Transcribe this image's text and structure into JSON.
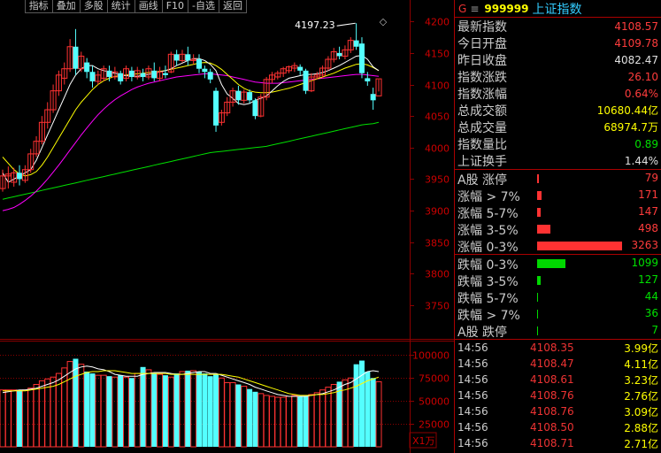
{
  "toolbar": [
    "指标",
    "叠加",
    "多股",
    "统计",
    "画线",
    "F10",
    "-自选",
    "返回"
  ],
  "chart_data": {
    "type": "candlestick",
    "price_axis": {
      "ticks": [
        4200,
        4150,
        4100,
        4050,
        4000,
        3950,
        3900,
        3850,
        3800,
        3750
      ],
      "ylim": [
        3698,
        4213
      ]
    },
    "volume_axis": {
      "ticks": [
        100000,
        75000,
        50000,
        25000
      ],
      "ylim": [
        0,
        109000
      ],
      "unit_label": "X1万"
    },
    "high_annotation": "4197.23",
    "candles": [
      [
        3935,
        3955,
        3930,
        3965
      ],
      [
        3955,
        3958,
        3935,
        3970
      ],
      [
        3945,
        3960,
        3938,
        3968
      ],
      [
        3960,
        3950,
        3940,
        3972
      ],
      [
        3948,
        3965,
        3944,
        3972
      ],
      [
        3965,
        3990,
        3960,
        3998
      ],
      [
        3990,
        4010,
        3985,
        4018
      ],
      [
        4010,
        4040,
        4005,
        4050
      ],
      [
        4040,
        4060,
        4030,
        4072
      ],
      [
        4060,
        4090,
        4055,
        4100
      ],
      [
        4090,
        4115,
        4082,
        4122
      ],
      [
        4110,
        4125,
        4100,
        4135
      ],
      [
        4125,
        4160,
        4120,
        4172
      ],
      [
        4160,
        4125,
        4115,
        4188
      ],
      [
        4125,
        4145,
        4120,
        4152
      ],
      [
        4135,
        4120,
        4110,
        4142
      ],
      [
        4120,
        4105,
        4095,
        4130
      ],
      [
        4105,
        4115,
        4100,
        4122
      ],
      [
        4110,
        4125,
        4105,
        4130
      ],
      [
        4122,
        4112,
        4105,
        4130
      ],
      [
        4112,
        4120,
        4108,
        4128
      ],
      [
        4118,
        4105,
        4100,
        4122
      ],
      [
        4110,
        4125,
        4105,
        4130
      ],
      [
        4122,
        4112,
        4105,
        4128
      ],
      [
        4112,
        4122,
        4108,
        4128
      ],
      [
        4118,
        4112,
        4105,
        4125
      ],
      [
        4112,
        4125,
        4108,
        4130
      ],
      [
        4122,
        4110,
        4105,
        4135
      ],
      [
        4110,
        4120,
        4105,
        4128
      ],
      [
        4118,
        4115,
        4110,
        4130
      ],
      [
        4120,
        4148,
        4118,
        4152
      ],
      [
        4148,
        4138,
        4130,
        4155
      ],
      [
        4138,
        4148,
        4135,
        4155
      ],
      [
        4148,
        4138,
        4130,
        4160
      ],
      [
        4138,
        4140,
        4132,
        4148
      ],
      [
        4140,
        4125,
        4118,
        4148
      ],
      [
        4125,
        4120,
        4110,
        4130
      ],
      [
        4120,
        4108,
        4102,
        4125
      ],
      [
        4090,
        4035,
        4025,
        4095
      ],
      [
        4040,
        4055,
        4035,
        4060
      ],
      [
        4055,
        4072,
        4050,
        4080
      ],
      [
        4072,
        4090,
        4065,
        4095
      ],
      [
        4090,
        4075,
        4068,
        4098
      ],
      [
        4075,
        4088,
        4070,
        4092
      ],
      [
        4088,
        4075,
        4070,
        4092
      ],
      [
        4075,
        4050,
        4045,
        4078
      ],
      [
        4050,
        4080,
        4048,
        4085
      ],
      [
        4080,
        4108,
        4075,
        4112
      ],
      [
        4108,
        4115,
        4102,
        4120
      ],
      [
        4112,
        4118,
        4108,
        4122
      ],
      [
        4118,
        4125,
        4112,
        4128
      ],
      [
        4122,
        4128,
        4118,
        4130
      ],
      [
        4126,
        4130,
        4120,
        4135
      ],
      [
        4128,
        4122,
        4115,
        4132
      ],
      [
        4122,
        4090,
        4085,
        4125
      ],
      [
        4090,
        4112,
        4088,
        4118
      ],
      [
        4112,
        4115,
        4108,
        4120
      ],
      [
        4115,
        4126,
        4110,
        4130
      ],
      [
        4126,
        4140,
        4122,
        4145
      ],
      [
        4140,
        4152,
        4135,
        4158
      ],
      [
        4150,
        4145,
        4140,
        4160
      ],
      [
        4145,
        4155,
        4140,
        4162
      ],
      [
        4155,
        4170,
        4150,
        4175
      ],
      [
        4170,
        4160,
        4155,
        4197.23
      ],
      [
        4165,
        4118,
        4110,
        4175
      ],
      [
        4110,
        4105,
        4098,
        4120
      ],
      [
        4085,
        4075,
        4060,
        4095
      ],
      [
        4082,
        4109,
        4089,
        4108
      ]
    ],
    "ma5": [
      3960,
      3945,
      3950,
      3955,
      3960,
      3965,
      3980,
      4000,
      4020,
      4040,
      4060,
      4080,
      4100,
      4115,
      4125,
      4130,
      4130,
      4125,
      4122,
      4120,
      4118,
      4115,
      4114,
      4113,
      4113,
      4115,
      4116,
      4118,
      4120,
      4122,
      4125,
      4130,
      4134,
      4138,
      4141,
      4141,
      4138,
      4132,
      4122,
      4100,
      4085,
      4078,
      4070,
      4068,
      4070,
      4075,
      4078,
      4082,
      4090,
      4098,
      4105,
      4110,
      4112,
      4114,
      4116,
      4116,
      4117,
      4119,
      4122,
      4126,
      4130,
      4135,
      4140,
      4145,
      4146,
      4140,
      4128,
      4122
    ],
    "ma10": [
      3985,
      3975,
      3965,
      3958,
      3955,
      3957,
      3962,
      3972,
      3985,
      4000,
      4015,
      4030,
      4045,
      4060,
      4072,
      4082,
      4092,
      4100,
      4106,
      4110,
      4113,
      4114,
      4115,
      4116,
      4117,
      4118,
      4119,
      4120,
      4121,
      4122,
      4124,
      4126,
      4128,
      4130,
      4132,
      4134,
      4135,
      4134,
      4130,
      4124,
      4116,
      4108,
      4100,
      4094,
      4090,
      4088,
      4087,
      4087,
      4088,
      4090,
      4092,
      4094,
      4097,
      4100,
      4103,
      4106,
      4109,
      4112,
      4115,
      4118,
      4122,
      4126,
      4129,
      4132,
      4133,
      4131,
      4127,
      4122
    ],
    "ma20": [
      3900,
      3902,
      3905,
      3910,
      3916,
      3923,
      3931,
      3940,
      3950,
      3961,
      3972,
      3984,
      3996,
      4008,
      4020,
      4031,
      4042,
      4052,
      4061,
      4069,
      4076,
      4082,
      4087,
      4092,
      4096,
      4099,
      4102,
      4104,
      4106,
      4108,
      4110,
      4112,
      4113,
      4114,
      4115,
      4116,
      4117,
      4117,
      4116,
      4115,
      4114,
      4112,
      4110,
      4108,
      4106,
      4104,
      4103,
      4102,
      4102,
      4102,
      4103,
      4104,
      4105,
      4106,
      4107,
      4108,
      4109,
      4110,
      4111,
      4112,
      4113,
      4114,
      4115,
      4116,
      4116,
      4115,
      4114,
      4113
    ],
    "ma60": [
      3918,
      3920,
      3922,
      3924,
      3926,
      3928,
      3930,
      3932,
      3934,
      3936,
      3938,
      3940,
      3942,
      3944,
      3946,
      3948,
      3950,
      3952,
      3954,
      3956,
      3958,
      3960,
      3962,
      3964,
      3966,
      3968,
      3970,
      3972,
      3974,
      3976,
      3978,
      3980,
      3982,
      3984,
      3986,
      3988,
      3990,
      3992,
      3993,
      3994,
      3995,
      3996,
      3997,
      3998,
      3999,
      4000,
      4001,
      4002,
      4004,
      4006,
      4008,
      4010,
      4012,
      4014,
      4016,
      4018,
      4020,
      4022,
      4024,
      4026,
      4028,
      4030,
      4032,
      4034,
      4036,
      4037,
      4038,
      4040
    ],
    "volumes": [
      62000,
      62000,
      62000,
      62000,
      62000,
      64000,
      68000,
      72000,
      74000,
      76000,
      80000,
      86000,
      93000,
      96000,
      90000,
      82000,
      80000,
      78000,
      78000,
      77000,
      76000,
      78000,
      76000,
      75000,
      80000,
      87000,
      84000,
      80000,
      79000,
      78000,
      76000,
      80000,
      82000,
      83000,
      83000,
      82000,
      80000,
      77000,
      79000,
      75000,
      70000,
      70000,
      68000,
      66000,
      63000,
      60000,
      58000,
      56000,
      55000,
      54000,
      54000,
      55000,
      56000,
      55000,
      55000,
      57000,
      59000,
      62000,
      65000,
      68000,
      71000,
      73000,
      75000,
      90000,
      94000,
      82000,
      75000,
      71000
    ],
    "vol_ma5": [
      59000,
      60000,
      61000,
      62000,
      62000,
      63000,
      64000,
      66000,
      68000,
      70000,
      73000,
      77000,
      81000,
      85000,
      87000,
      88000,
      87000,
      85000,
      84000,
      82000,
      79000,
      78000,
      77000,
      77000,
      77000,
      79000,
      80000,
      81000,
      81000,
      81000,
      80000,
      79000,
      79000,
      80000,
      81000,
      82000,
      82000,
      80000,
      80000,
      78000,
      76000,
      74000,
      72000,
      70000,
      68000,
      65000,
      63000,
      61000,
      59000,
      57000,
      56000,
      55000,
      55000,
      55000,
      55000,
      56000,
      57000,
      58000,
      60000,
      62000,
      65000,
      68000,
      70000,
      74000,
      78000,
      82000,
      83000,
      82000
    ],
    "vol_ma10": [
      61000,
      61000,
      61000,
      61000,
      61000,
      62000,
      63000,
      64000,
      65000,
      66000,
      68000,
      71000,
      74000,
      77000,
      79000,
      81000,
      82000,
      82000,
      83000,
      83000,
      83000,
      82000,
      81000,
      80000,
      80000,
      80000,
      80000,
      80000,
      80000,
      80000,
      79000,
      79000,
      79000,
      79000,
      79000,
      79000,
      79000,
      79000,
      79000,
      79000,
      78000,
      77000,
      76000,
      74000,
      72000,
      70000,
      68000,
      66000,
      64000,
      62000,
      60000,
      58000,
      57000,
      56000,
      56000,
      56000,
      57000,
      57000,
      58000,
      59000,
      61000,
      62000,
      64000,
      66000,
      69000,
      72000,
      74000,
      76000
    ]
  },
  "panel": {
    "g": "G",
    "menu": "≡",
    "code": "999999",
    "name": "上证指数",
    "stats": [
      {
        "label": "最新指数",
        "value": "4108.57",
        "color": "#ff3c3c"
      },
      {
        "label": "今日开盘",
        "value": "4109.78",
        "color": "#ff3c3c"
      },
      {
        "label": "昨日收盘",
        "value": "4082.47",
        "color": "#e0e0e0"
      },
      {
        "label": "指数涨跌",
        "value": "26.10",
        "color": "#ff3c3c"
      },
      {
        "label": "指数涨幅",
        "value": "0.64%",
        "color": "#ff3c3c"
      },
      {
        "label": "总成交额",
        "value": "10680.44亿",
        "color": "#ffff00"
      },
      {
        "label": "总成交量",
        "value": "68974.7万",
        "color": "#ffff00"
      },
      {
        "label": "指数量比",
        "value": "0.89",
        "color": "#00e000"
      },
      {
        "label": "上证换手",
        "value": "1.44%",
        "color": "#e0e0e0"
      }
    ],
    "up_bars": [
      {
        "label": "A股 涨停",
        "value": "79",
        "count": 79
      },
      {
        "label": "涨幅 > 7%",
        "value": "171",
        "count": 171
      },
      {
        "label": "涨幅 5-7%",
        "value": "147",
        "count": 147
      },
      {
        "label": "涨幅 3-5%",
        "value": "498",
        "count": 498
      },
      {
        "label": "涨幅 0-3%",
        "value": "3263",
        "count": 3263
      }
    ],
    "down_bars": [
      {
        "label": "跌幅 0-3%",
        "value": "1099",
        "count": 1099
      },
      {
        "label": "跌幅 3-5%",
        "value": "127",
        "count": 127
      },
      {
        "label": "跌幅 5-7%",
        "value": "44",
        "count": 44
      },
      {
        "label": "跌幅 > 7%",
        "value": "36",
        "count": 36
      },
      {
        "label": "A股 跌停",
        "value": "7",
        "count": 7
      }
    ],
    "ticks": [
      {
        "time": "14:56",
        "price": "4108.35",
        "amount": "3.99亿"
      },
      {
        "time": "14:56",
        "price": "4108.47",
        "amount": "4.11亿"
      },
      {
        "time": "14:56",
        "price": "4108.61",
        "amount": "3.23亿"
      },
      {
        "time": "14:56",
        "price": "4108.76",
        "amount": "2.76亿"
      },
      {
        "time": "14:56",
        "price": "4108.76",
        "amount": "3.09亿"
      },
      {
        "time": "14:56",
        "price": "4108.50",
        "amount": "2.88亿"
      },
      {
        "time": "14:56",
        "price": "4108.71",
        "amount": "2.71亿"
      }
    ]
  },
  "colors": {
    "up": "#ff3232",
    "down": "#54ffff",
    "ma5": "#ffffff",
    "ma10": "#ffff00",
    "ma20": "#ff00ff",
    "ma60": "#00e000",
    "grid": "#8b0000"
  }
}
